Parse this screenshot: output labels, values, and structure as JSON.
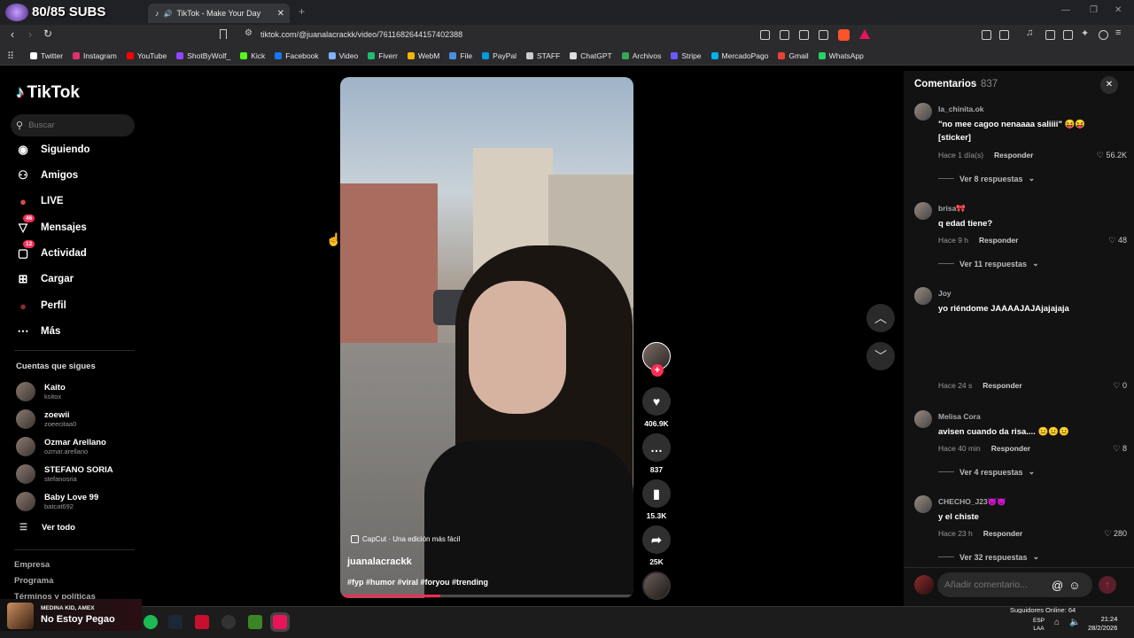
{
  "overlay": {
    "subs": "80/85 SUBS"
  },
  "browser": {
    "tab_title": "TikTok - Make Your Day",
    "url": "tiktok.com/@juanalacrackk/video/7611682644157402388",
    "bookmarks": [
      {
        "label": "Twitter",
        "color": "#ffffff"
      },
      {
        "label": "Instagram",
        "color": "#e1306c"
      },
      {
        "label": "YouTube",
        "color": "#ff0000"
      },
      {
        "label": "ShotByWolf_",
        "color": "#9146ff"
      },
      {
        "label": "Kick",
        "color": "#53fc18"
      },
      {
        "label": "Facebook",
        "color": "#1877f2"
      },
      {
        "label": "Video",
        "color": "#7fb3ff"
      },
      {
        "label": "Fiverr",
        "color": "#1dbf73"
      },
      {
        "label": "WebM",
        "color": "#f5b400"
      },
      {
        "label": "File",
        "color": "#4a90e2"
      },
      {
        "label": "PayPal",
        "color": "#009cde"
      },
      {
        "label": "STAFF",
        "color": "#cccccc"
      },
      {
        "label": "ChatGPT",
        "color": "#dddddd"
      },
      {
        "label": "Archivos",
        "color": "#34a853"
      },
      {
        "label": "Stripe",
        "color": "#635bff"
      },
      {
        "label": "MercadoPago",
        "color": "#00b1ea"
      },
      {
        "label": "Gmail",
        "color": "#ea4335"
      },
      {
        "label": "WhatsApp",
        "color": "#25d366"
      }
    ]
  },
  "sidebar": {
    "logo": "TikTok",
    "search_placeholder": "Buscar",
    "nav": [
      {
        "label": "Siguiendo",
        "icon": "following-avatar-icon"
      },
      {
        "label": "Amigos",
        "icon": "friends-icon"
      },
      {
        "label": "LIVE",
        "icon": "live-icon"
      },
      {
        "label": "Mensajes",
        "icon": "messages-icon",
        "badge": "46"
      },
      {
        "label": "Actividad",
        "icon": "activity-icon",
        "badge": "12"
      },
      {
        "label": "Cargar",
        "icon": "upload-icon"
      },
      {
        "label": "Perfil",
        "icon": "profile-icon"
      },
      {
        "label": "Más",
        "icon": "more-icon"
      }
    ],
    "following_title": "Cuentas que sigues",
    "following": [
      {
        "name": "Kaito",
        "handle": "ksitox"
      },
      {
        "name": "zoewii",
        "handle": "zoeecitaa0"
      },
      {
        "name": "Ozmar Arellano",
        "handle": "ozmar.arellano"
      },
      {
        "name": "STEFANO SORIA",
        "handle": "stefanosria"
      },
      {
        "name": "Baby Love 99",
        "handle": "batcat692"
      }
    ],
    "see_all": "Ver todo",
    "footer": [
      "Empresa",
      "Programa",
      "Términos y políticas"
    ]
  },
  "video": {
    "watermark": "CapCut · Una edición más fácil",
    "author": "juanalacrackk",
    "hashtags": "#fyp #humor #viral #foryou #trending",
    "progress": 0.34
  },
  "actions": [
    {
      "icon": "heart-icon",
      "count": "406.9K"
    },
    {
      "icon": "comment-icon",
      "count": "837"
    },
    {
      "icon": "bookmark-icon",
      "count": "15.3K"
    },
    {
      "icon": "share-icon",
      "count": "25K"
    }
  ],
  "comments_panel": {
    "title": "Comentarios",
    "count": "837",
    "input_placeholder": "Añadir comentario...",
    "comments": [
      {
        "user": "la_chinita.ok",
        "text": "\"no mee cagoo nenaaaa saliiii\" 😝😝 [sticker]",
        "time": "Hace 1 día(s)",
        "reply": "Responder",
        "likes": "56.2K",
        "more": "Ver 8 respuestas"
      },
      {
        "user": "brisa🎀",
        "text": "q edad tiene?",
        "time": "Hace 9 h",
        "reply": "Responder",
        "likes": "48",
        "more": "Ver 11 respuestas"
      },
      {
        "user": "Joy",
        "text": "yo riéndome JAAAAJAJAjajajaja",
        "time": "Hace 24 s",
        "reply": "Responder",
        "likes": "0"
      },
      {
        "user": "Melisa Cora",
        "text": "avisen cuando da risa.... 😐😐😐",
        "time": "Hace 40 min",
        "reply": "Responder",
        "likes": "8",
        "more": "Ver 4 respuestas"
      },
      {
        "user": "CHECHO_J23😈😈",
        "text": "y el chiste",
        "time": "Hace 23 h",
        "reply": "Responder",
        "likes": "280",
        "more": "Ver 32 respuestas"
      }
    ]
  },
  "taskbar": {
    "media_artist": "MEDINA KID, AMEX",
    "media_title": "No Estoy Pegao",
    "ticker": "Suguidores Online: 64",
    "lang": "ESP",
    "lang2": "LAA",
    "time": "21:24",
    "date": "28/2/2026"
  }
}
